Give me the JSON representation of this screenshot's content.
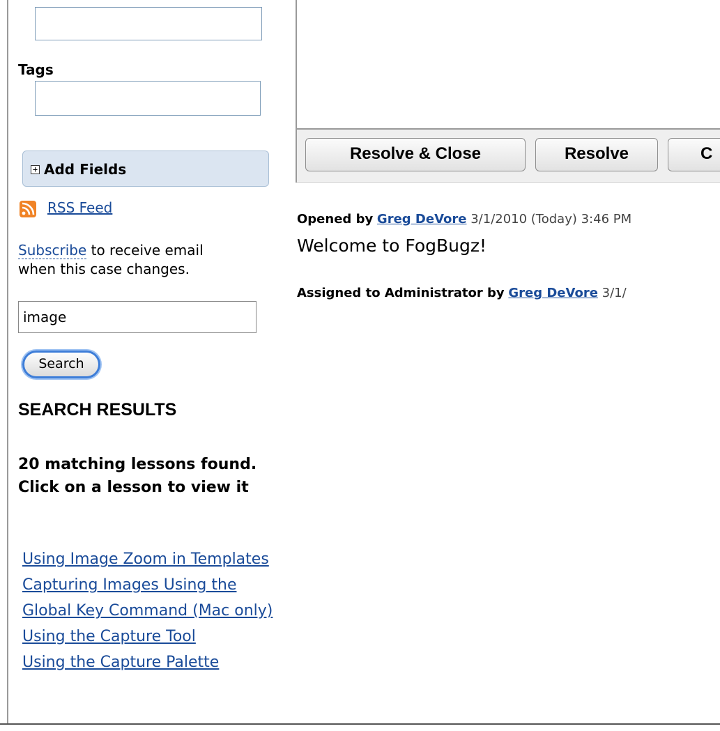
{
  "sidebar": {
    "tags_label": "Tags",
    "add_fields_label": "Add Fields",
    "rss_link": "RSS Feed",
    "subscribe_link": "Subscribe",
    "subscribe_text_1": " to receive email",
    "subscribe_text_2": "when this case changes.",
    "search_value": "image",
    "search_button": "Search",
    "results_title": "SEARCH RESULTS",
    "results_summary": "20 matching lessons found. Click on a lesson to view it",
    "lessons": [
      "Using Image Zoom in Templates",
      "Capturing Images Using the Global Key Command (Mac only)",
      "Using the Capture Tool",
      "Using the Capture Palette"
    ]
  },
  "toolbar": {
    "resolve_close": "Resolve & Close",
    "resolve": "Resolve",
    "third": "C"
  },
  "events": {
    "opened_prefix": "Opened by",
    "opened_user": "Greg DeVore",
    "opened_date": "3/1/2010 (Today) 3:46 PM",
    "welcome": "Welcome to FogBugz!",
    "assigned_prefix": "Assigned to Administrator by",
    "assigned_user": "Greg DeVore",
    "assigned_date": "3/1/"
  },
  "colors": {
    "link": "#1a4b99",
    "rss": "#f08326",
    "add_fields_bg": "#dbe5f1"
  },
  "icons": {
    "rss": "rss-icon",
    "expand": "plus-box-icon"
  }
}
